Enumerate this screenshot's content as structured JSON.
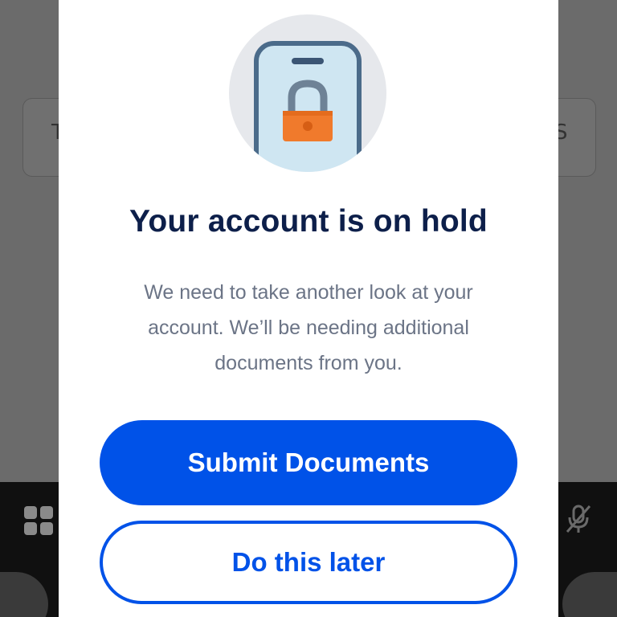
{
  "modal": {
    "title": "Your account is on hold",
    "body": "We need to take another look at your account. We’ll be needing additional documents from you.",
    "primary_button_label": "Submit Documents",
    "secondary_button_label": "Do this later",
    "hero_icon": "phone-lock-icon"
  },
  "background": {
    "card_left_glyph": "T",
    "card_right_glyph": "S",
    "menu_icon": "grid-icon",
    "mic_icon": "mic-off-icon"
  },
  "colors": {
    "brand_blue": "#0052e8",
    "title_navy": "#0d1f4a",
    "body_gray": "#6b7486",
    "lock_orange": "#f07a2c",
    "overlay_gray": "#6b6b6b"
  }
}
